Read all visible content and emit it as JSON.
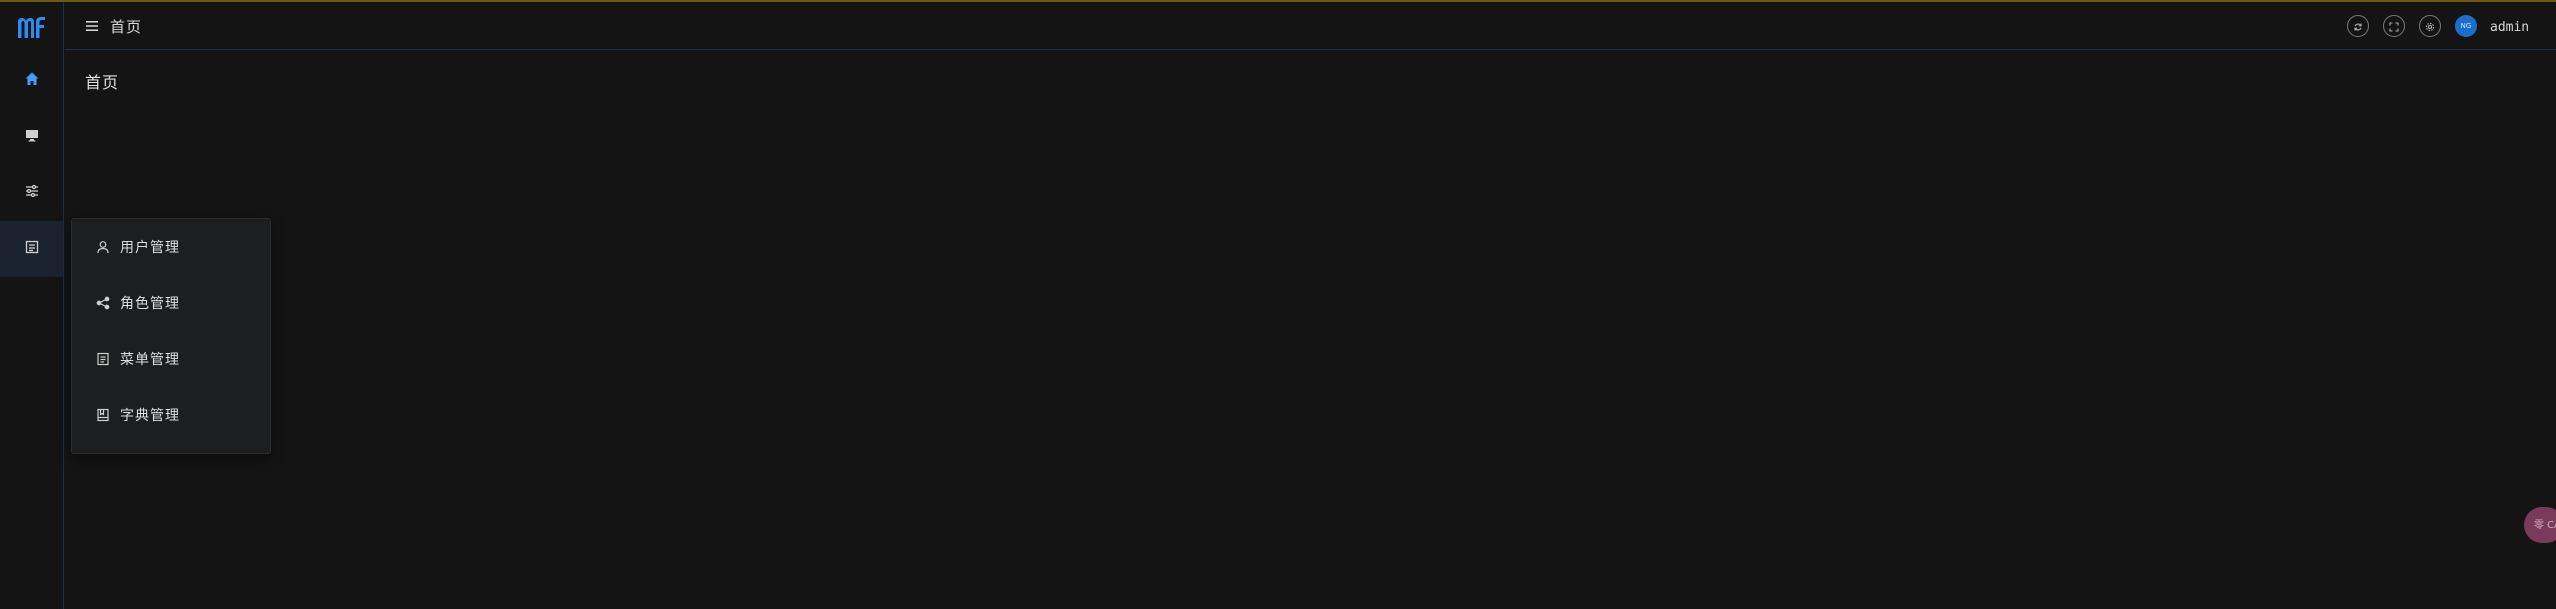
{
  "app": {
    "logo_text": "Mf"
  },
  "header": {
    "title": "首页",
    "user": {
      "name": "admin",
      "avatar_text": "NG"
    }
  },
  "main": {
    "page_title": "首页"
  },
  "sidebar": {
    "items": [
      {
        "icon": "home-icon"
      },
      {
        "icon": "monitor-icon"
      },
      {
        "icon": "sliders-icon"
      },
      {
        "icon": "system-icon"
      }
    ]
  },
  "submenu": {
    "items": [
      {
        "label": "用户管理",
        "icon": "user-icon"
      },
      {
        "label": "角色管理",
        "icon": "share-icon"
      },
      {
        "label": "菜单管理",
        "icon": "document-icon"
      },
      {
        "label": "字典管理",
        "icon": "book-icon"
      }
    ]
  },
  "widget": {
    "text": "零 CA"
  },
  "colors": {
    "accent": "#409eff",
    "topline": "#6b5a14",
    "background": "#141414"
  }
}
